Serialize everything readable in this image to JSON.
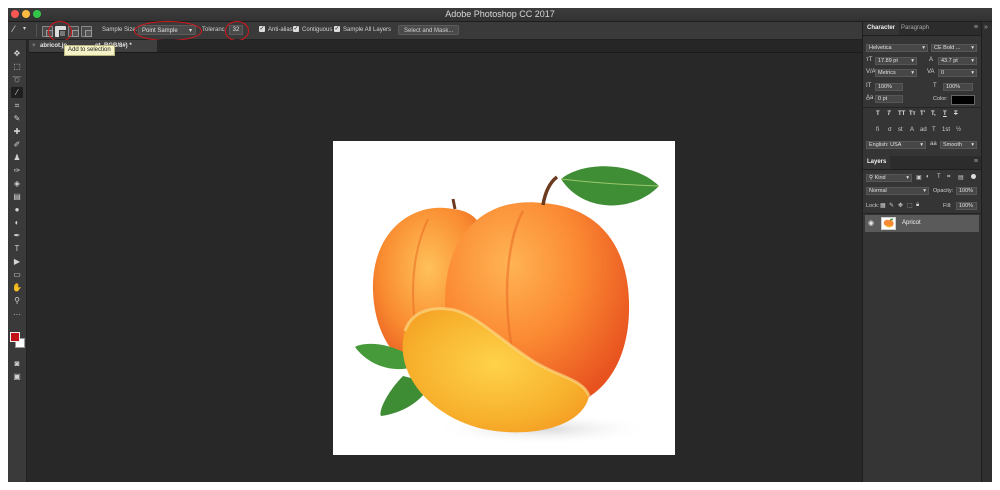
{
  "window": {
    "title": "Adobe Photoshop CC 2017"
  },
  "options_bar": {
    "sample_size_label": "Sample Size:",
    "sample_size_value": "Point Sample",
    "tolerance_label": "Toleranc",
    "tolerance_value": "32",
    "anti_alias_label": "Anti-alias",
    "contiguous_label": "Contiguous",
    "sample_all_layers_label": "Sample All Layers",
    "select_and_mask_label": "Select and Mask...",
    "check_glyph": "✓"
  },
  "tooltip": {
    "text": "Add to selection"
  },
  "document_tab": {
    "close": "×",
    "title": "abricot.jp",
    "title_rest": "ot, RGB/8#) *"
  },
  "character_panel": {
    "tabs": [
      "Character",
      "Paragraph"
    ],
    "font_family": "Helvetica",
    "font_style": "CE Bold ...",
    "font_size": "17.89 pt",
    "leading": "43.7 pt",
    "kerning": "Metrics",
    "tracking": "0",
    "vertical_scale": "100%",
    "horizontal_scale": "100%",
    "baseline_shift": "0 pt",
    "color_label": "Color:",
    "type_styles": [
      "T",
      "T",
      "TT",
      "Tт",
      "T'",
      "T,",
      "T",
      "T"
    ],
    "opentype": [
      "fi",
      "σ",
      "st",
      "A",
      "ad",
      "T",
      "1st",
      "½"
    ],
    "language": "English: USA",
    "aa_icon": "aa",
    "antialias": "Smooth"
  },
  "layers_panel": {
    "tab": "Layers",
    "filter_kind": "Kind",
    "blend_mode": "Normal",
    "opacity_label": "Opacity:",
    "opacity_value": "100%",
    "lock_label": "Lock:",
    "fill_label": "Fill:",
    "fill_value": "100%",
    "layer_name": "Apricot"
  },
  "colors": {
    "annotation": "#d8161c",
    "foreground": "#c0121a",
    "background": "#ffffff"
  }
}
